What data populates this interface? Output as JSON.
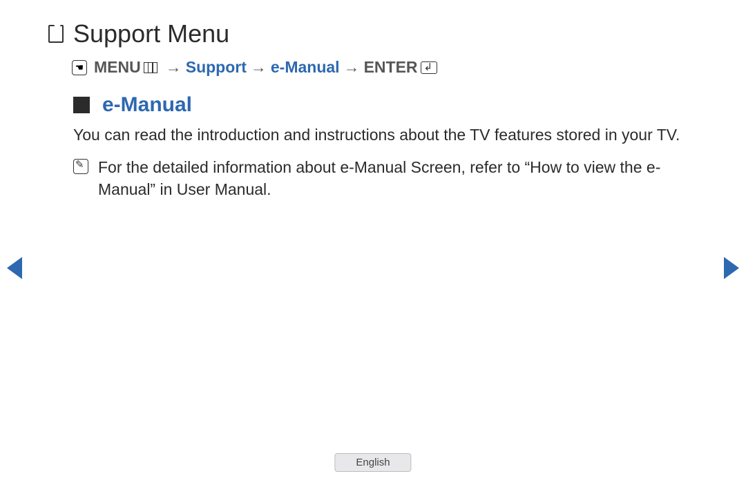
{
  "title": "Support Menu",
  "breadcrumb": {
    "menu_label": "MENU",
    "part2": "Support",
    "part3": "e-Manual",
    "enter_label": "ENTER"
  },
  "section": {
    "heading": "e-Manual",
    "body": "You can read the introduction and instructions about the TV features stored in your TV.",
    "note": "For the detailed information about e-Manual Screen, refer to “How to view the e-Manual” in User Manual."
  },
  "footer": {
    "language": "English"
  }
}
